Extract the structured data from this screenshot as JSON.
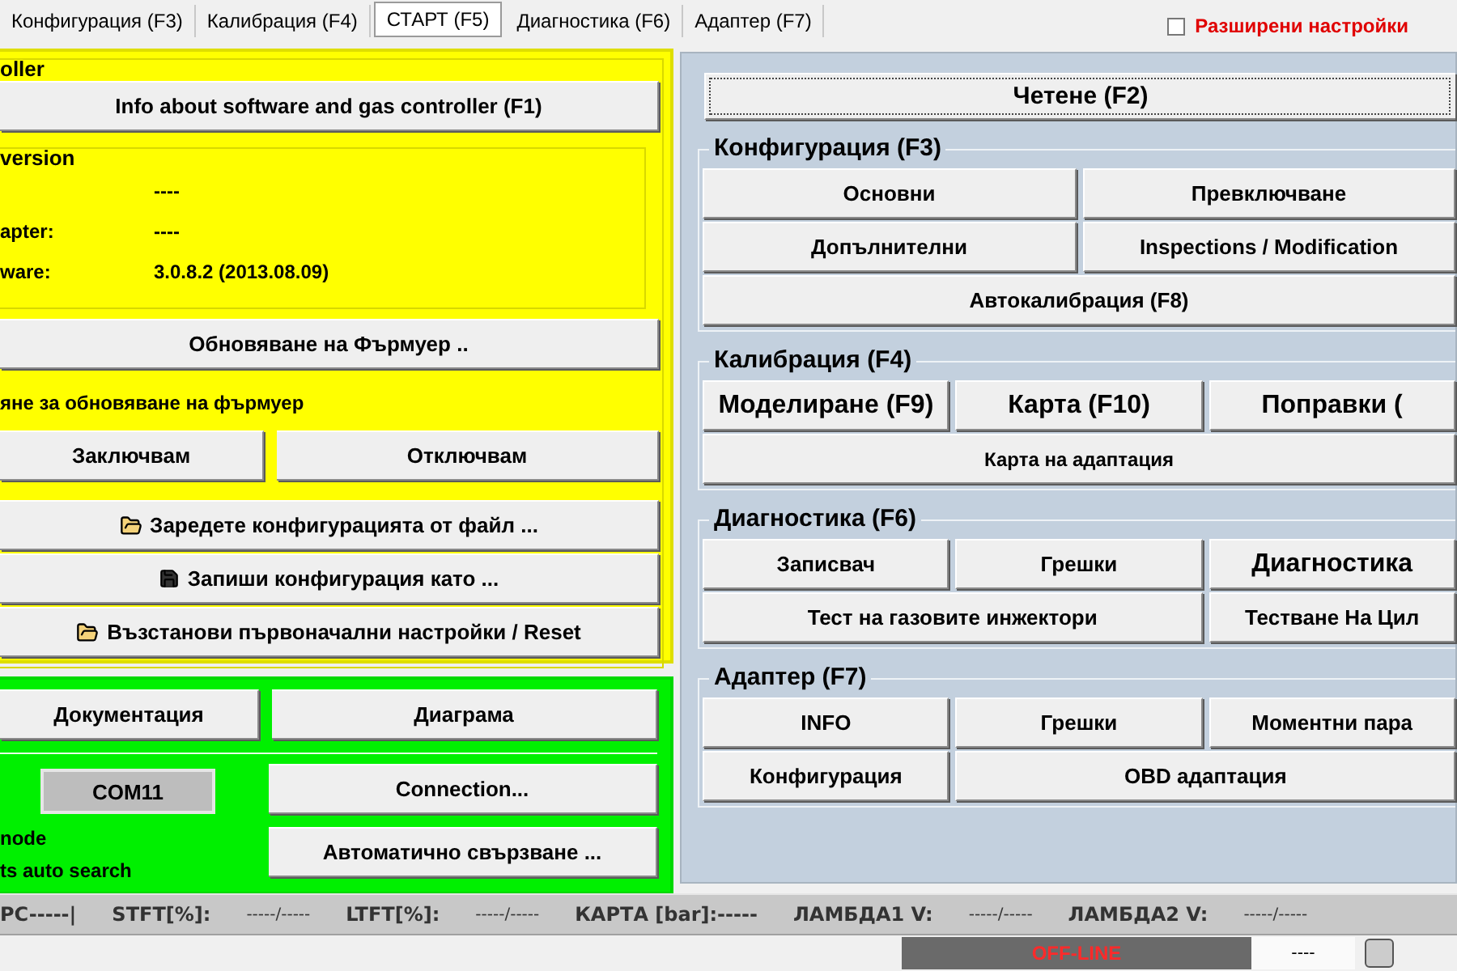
{
  "tabs": [
    {
      "label": "Конфигурация (F3)",
      "selected": false
    },
    {
      "label": "Калибрация (F4)",
      "selected": false
    },
    {
      "label": "СТАРТ (F5)",
      "selected": true
    },
    {
      "label": "Диагностика (F6)",
      "selected": false
    },
    {
      "label": "Адаптер (F7)",
      "selected": false
    }
  ],
  "advanced": {
    "label": "Разширени настройки",
    "checked": false
  },
  "controller": {
    "legend": "oller",
    "info_button": "Info about software and gas controller (F1)",
    "version": {
      "legend": "version",
      "rows": [
        {
          "value": "----"
        },
        {
          "label": "apter:",
          "value": "----"
        },
        {
          "label": "ware:",
          "value": "3.0.8.2 (2013.08.09)"
        }
      ]
    },
    "firmware_button": "Обновяване на Фърмуер ..",
    "lock_label": "яне за обновяване на фърмуер",
    "lock_buttons": [
      "Заключвам",
      "Отключвам"
    ],
    "file_buttons": [
      {
        "label": "Заредете конфигурацията от файл ...",
        "kind": "open"
      },
      {
        "label": "Запиши конфигурация като ...",
        "kind": "save"
      },
      {
        "label": "Възстанови първоначални настройки / Reset",
        "kind": "open"
      }
    ]
  },
  "connection": {
    "doc_buttons": [
      "Документация",
      "Диаграма"
    ],
    "port": "COM11",
    "connect_button": "Connection...",
    "auto_button": "Автоматично свързване ...",
    "notes": [
      "node",
      "ts auto search"
    ]
  },
  "read_button": "Четене (F2)",
  "groups": [
    {
      "title": "Конфигурация (F3)",
      "lines": [
        {
          "buttons": [
            {
              "label": "Основни",
              "kind": "normal"
            },
            {
              "label": "Превключване",
              "kind": "normal"
            }
          ]
        },
        {
          "buttons": [
            {
              "label": "Допълнителни",
              "kind": "normal"
            },
            {
              "label": "Inspections / Modification",
              "kind": "normal"
            }
          ]
        },
        {
          "buttons": [
            {
              "label": "Автокалибрация (F8)",
              "kind": "wide"
            }
          ]
        }
      ]
    },
    {
      "title": "Калибрация (F4)",
      "lines": [
        {
          "buttons": [
            {
              "label": "Моделиране (F9)",
              "kind": "large"
            },
            {
              "label": "Карта (F10)",
              "kind": "large"
            },
            {
              "label": "Поправки (",
              "kind": "large"
            }
          ]
        },
        {
          "buttons": [
            {
              "label": "Карта на адаптация",
              "kind": "strip"
            }
          ]
        }
      ]
    },
    {
      "title": "Диагностика (F6)",
      "lines": [
        {
          "buttons": [
            {
              "label": "Записвач",
              "kind": "normal"
            },
            {
              "label": "Грешки",
              "kind": "normal"
            },
            {
              "label": "Диагностика",
              "kind": "large"
            }
          ]
        },
        {
          "buttons": [
            {
              "label": "Тест на газовите инжектори",
              "kind": "wide"
            },
            {
              "label": "Тестване На Цил",
              "kind": "normal"
            }
          ]
        }
      ]
    },
    {
      "title": "Адаптер (F7)",
      "lines": [
        {
          "buttons": [
            {
              "label": "INFO",
              "kind": "normal"
            },
            {
              "label": "Грешки",
              "kind": "normal"
            },
            {
              "label": "Моментни пара",
              "kind": "normal"
            }
          ]
        },
        {
          "buttons": [
            {
              "label": "Конфигурация",
              "kind": "normal"
            },
            {
              "label": "OBD адаптация",
              "kind": "wide"
            }
          ]
        }
      ]
    }
  ],
  "status_bar": [
    {
      "text": "PC-----|",
      "kind": "label"
    },
    {
      "text": "STFT[%]:",
      "kind": "label"
    },
    {
      "text": "-----/-----",
      "kind": "value"
    },
    {
      "text": "LTFT[%]:",
      "kind": "label"
    },
    {
      "text": "-----/-----",
      "kind": "value"
    },
    {
      "text": "КАРТА [bar]:-----",
      "kind": "label"
    },
    {
      "text": "ЛАМБДА1 V:",
      "kind": "label"
    },
    {
      "text": "-----/-----",
      "kind": "value"
    },
    {
      "text": "ЛАМБДА2  V:",
      "kind": "label"
    },
    {
      "text": "-----/-----",
      "kind": "value"
    }
  ],
  "footer": {
    "state": "OFF-LINE",
    "value": "----"
  }
}
